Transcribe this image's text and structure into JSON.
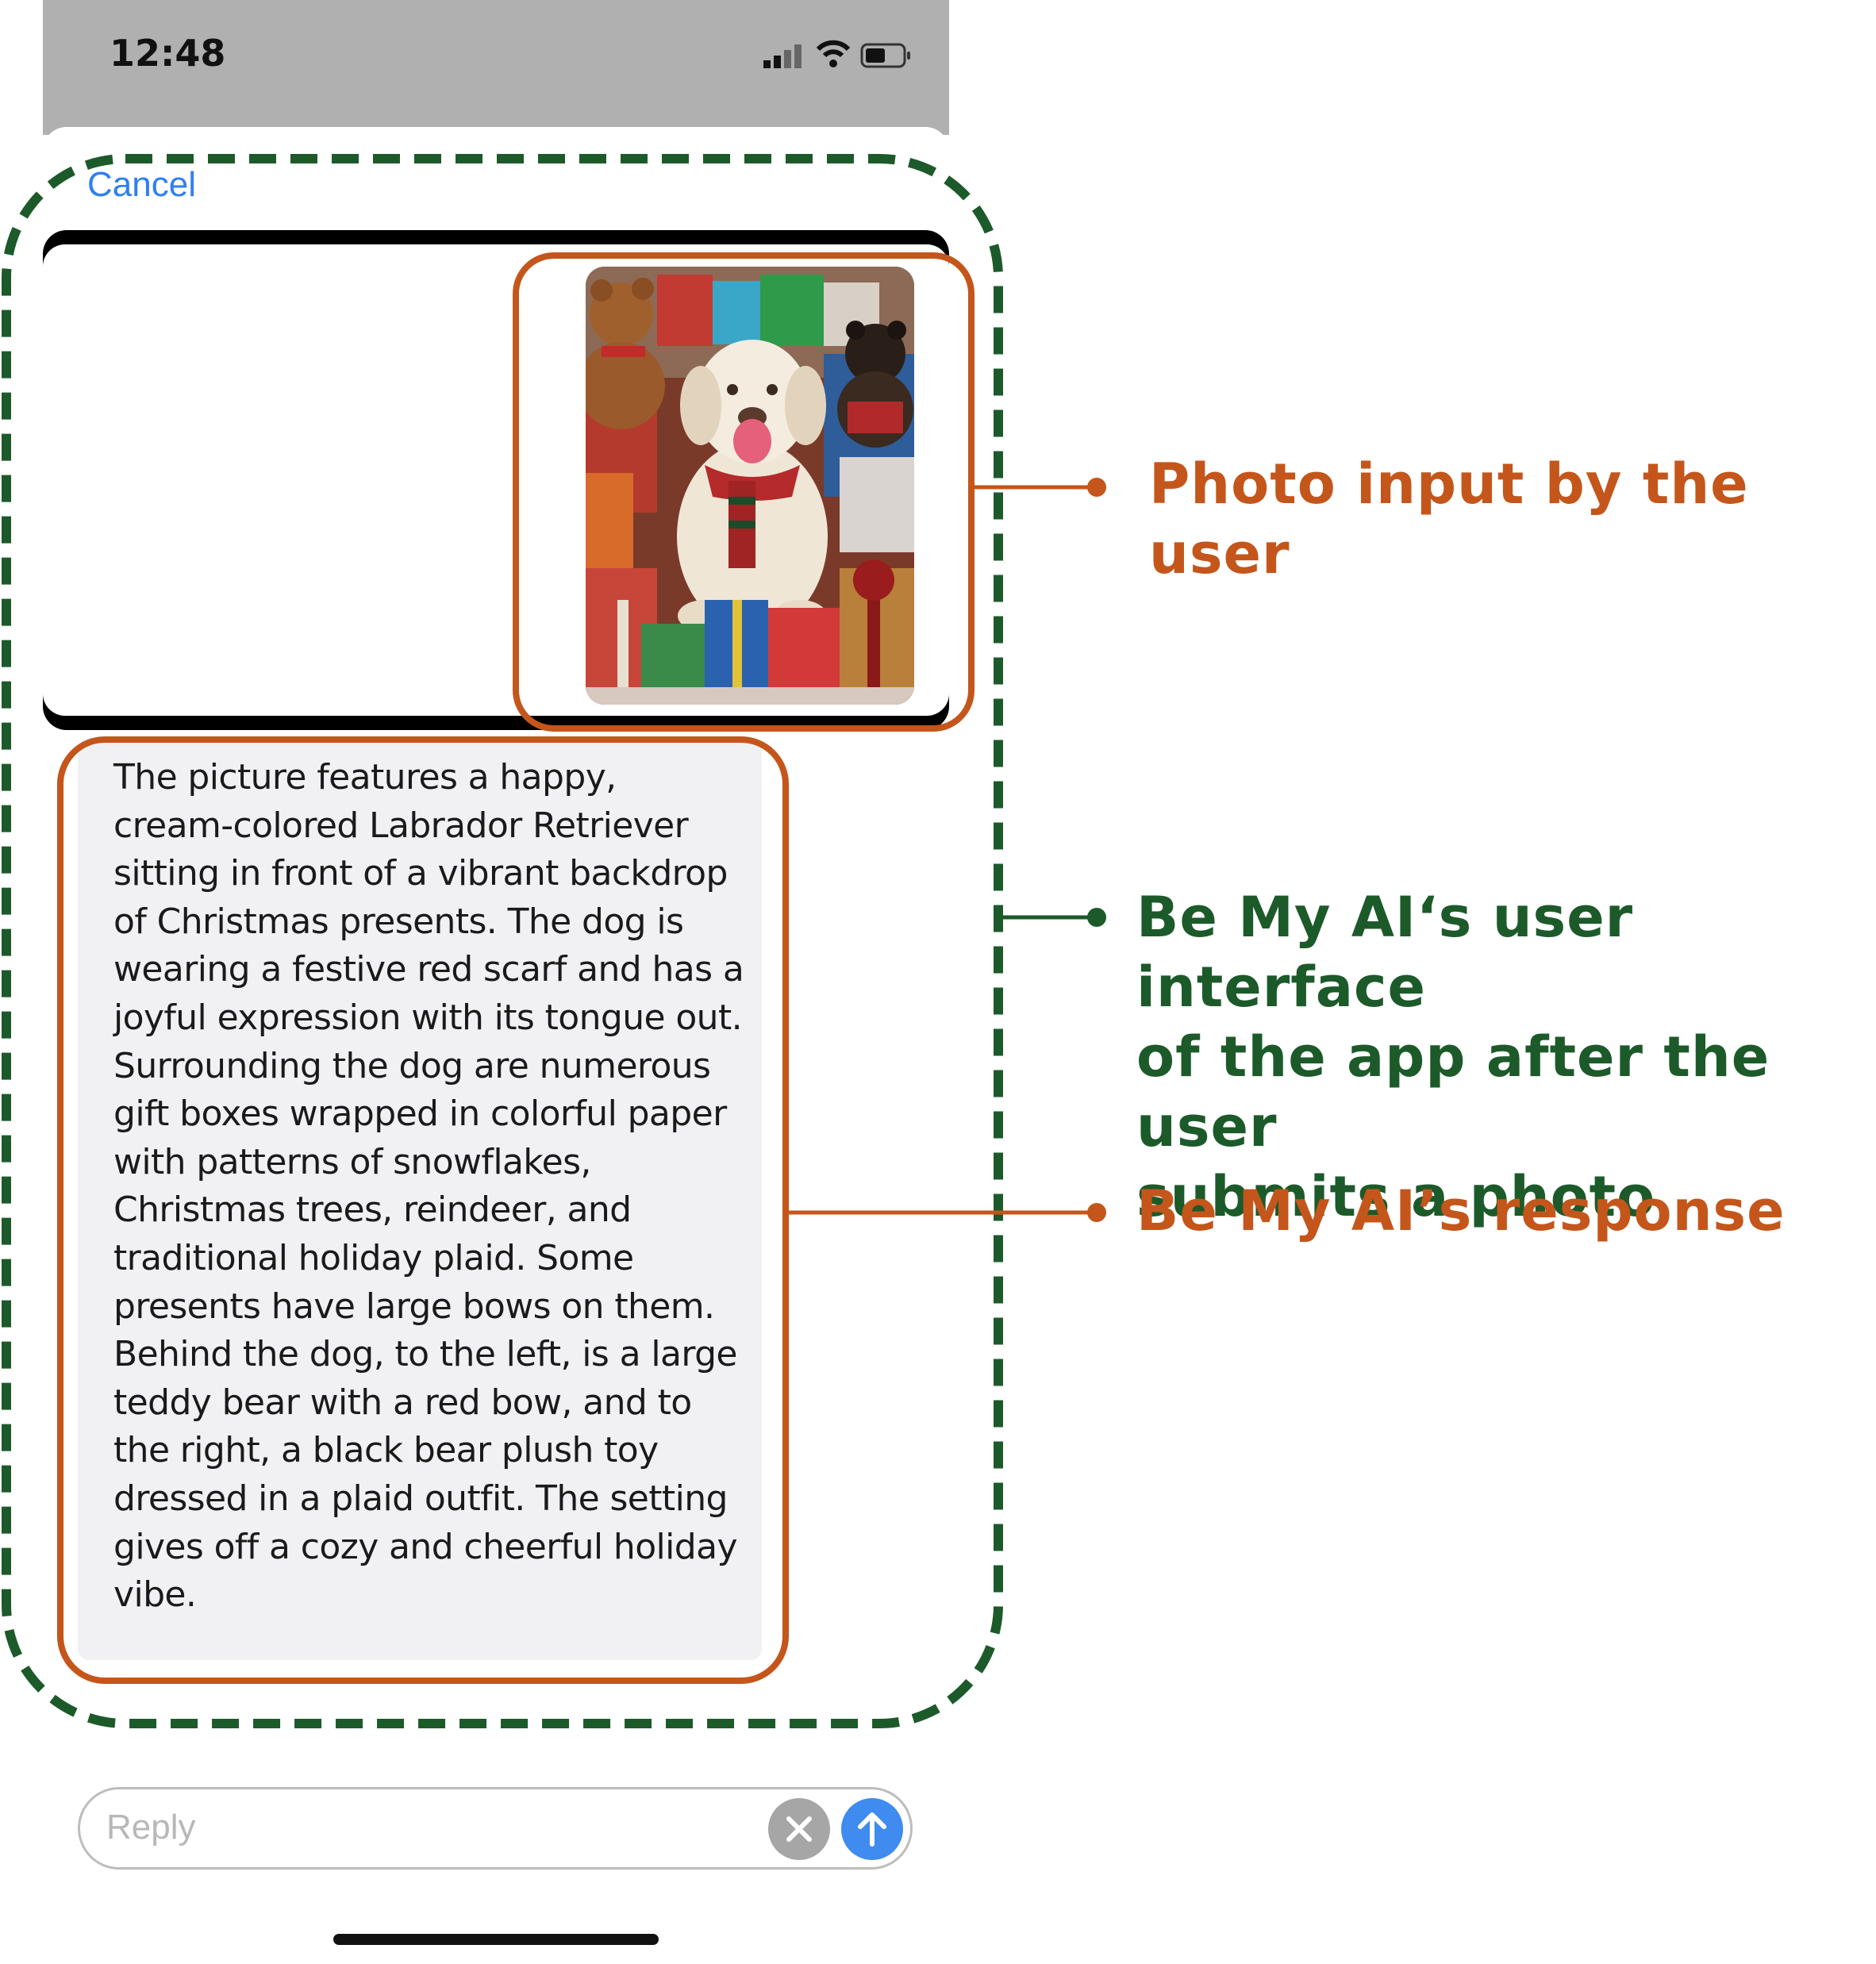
{
  "status_bar": {
    "time": "12:48"
  },
  "header": {
    "cancel_label": "Cancel"
  },
  "response": {
    "text": "The picture features a happy,\ncream-colored Labrador Retriever\nsitting in front of a vibrant backdrop\nof Christmas presents. The dog is\nwearing a festive red scarf and has a\njoyful expression with its tongue out.\nSurrounding the dog are numerous\ngift boxes wrapped in colorful paper\nwith patterns of snowflakes,\nChristmas trees, reindeer, and\ntraditional holiday plaid. Some\npresents have large bows on them.\nBehind the dog, to the left, is a large\nteddy bear with a red bow, and to\nthe right, a black bear plush toy\ndressed in a plaid outfit. The setting\ngives off a cozy and cheerful holiday\nvibe."
  },
  "reply": {
    "placeholder": "Reply"
  },
  "annotations": {
    "photo_label": "Photo input by the user",
    "ui_label": "Be My AI‘s user interface\nof the app after the user\nsubmits a photo",
    "response_label": "Be My AI’s response"
  },
  "colors": {
    "orange": "#c4561b",
    "green": "#1c5a2a",
    "link_blue": "#2f7ff0",
    "send_blue": "#3f8bef"
  }
}
